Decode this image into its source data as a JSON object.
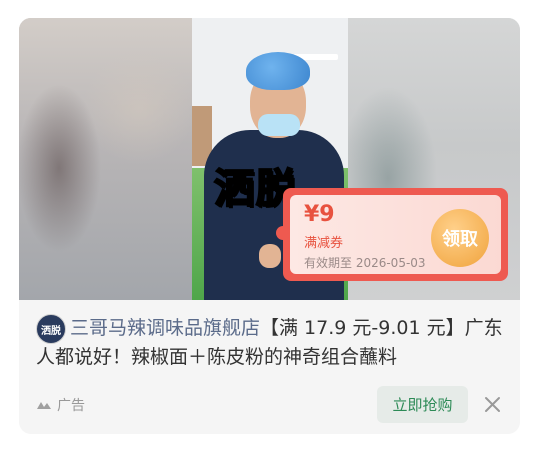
{
  "video": {
    "overlay_text": "洒脱"
  },
  "coupon": {
    "amount": "¥9",
    "type": "满减券",
    "validity": "有效期至 2026-05-03",
    "claim_label": "领取"
  },
  "ad": {
    "avatar_text": "洒脱",
    "shop_name": "三哥马辣调味品旗舰店",
    "description": "【满 17.9 元-9.01 元】广东人都说好！辣椒面＋陈皮粉的神奇组合蘸料",
    "ad_label": "广告",
    "cta_label": "立即抢购"
  },
  "colors": {
    "coupon_red": "#ee5a50",
    "cta_green": "#2c8a56",
    "shop_blue": "#5b6b8a"
  },
  "icons": {
    "ad_logo": "ad-source-icon",
    "close": "close-icon"
  }
}
